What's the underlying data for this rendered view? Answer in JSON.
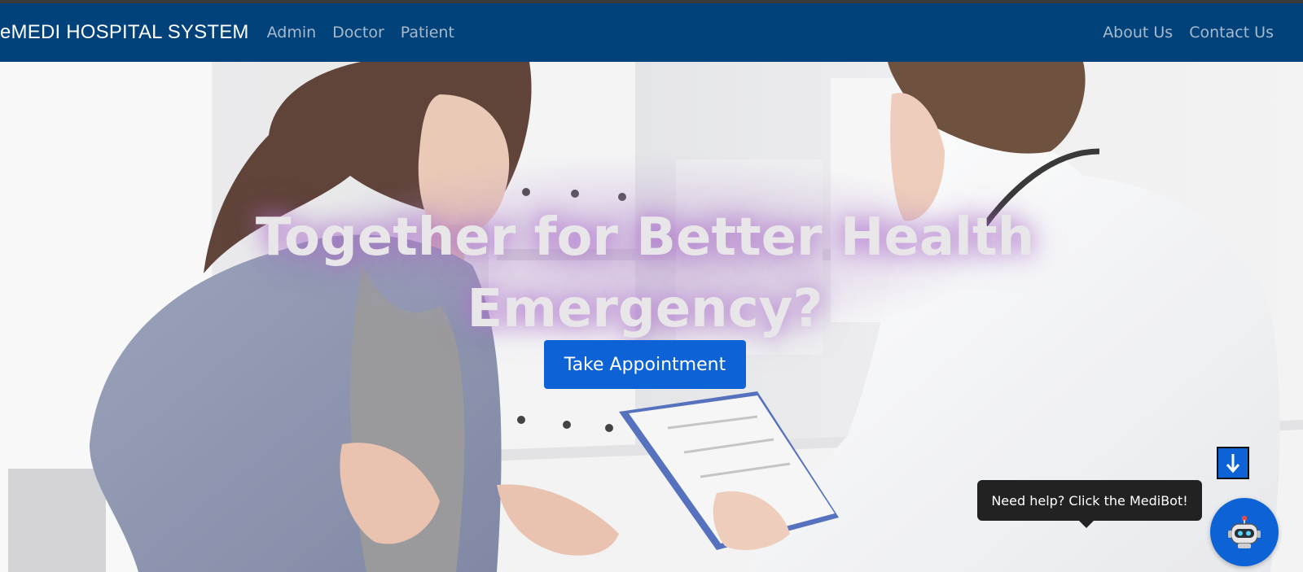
{
  "navbar": {
    "brand": "eMEDI HOSPITAL SYSTEM",
    "left_links": [
      "Admin",
      "Doctor",
      "Patient"
    ],
    "right_links": [
      "About Us",
      "Contact Us"
    ],
    "background": "#004279"
  },
  "hero": {
    "headline_line1": "Together for Better Health",
    "headline_line2": "Emergency?",
    "cta_label": "Take Appointment",
    "accent": "#0d63d6"
  },
  "chatbot": {
    "tooltip": "Need help? Click the MediBot!",
    "icon": "robot-icon",
    "scroll_icon": "arrow-down-icon"
  }
}
